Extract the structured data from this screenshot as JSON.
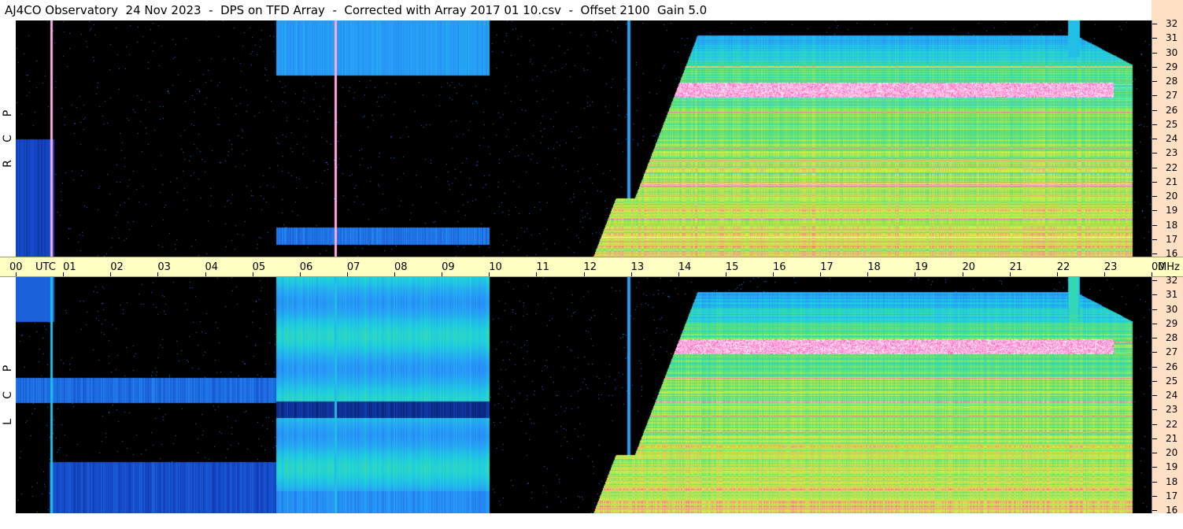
{
  "title": "AJ4CO Observatory  24 Nov 2023  -  DPS on TFD Array  -  Corrected with Array 2017 01 10.csv  -  Offset 2100  Gain 5.0",
  "panels": [
    {
      "id": "rcp",
      "polarization_letters": [
        "R",
        "C",
        "P"
      ]
    },
    {
      "id": "lcp",
      "polarization_letters": [
        "L",
        "C",
        "P"
      ]
    }
  ],
  "time_axis": {
    "labels": [
      "00",
      "UTC",
      "01",
      "02",
      "03",
      "04",
      "05",
      "06",
      "07",
      "08",
      "09",
      "10",
      "11",
      "12",
      "13",
      "14",
      "15",
      "16",
      "17",
      "18",
      "19",
      "20",
      "21",
      "22",
      "23",
      "00",
      "MHz"
    ]
  },
  "frequency_axis": {
    "labels": [
      "32",
      "31",
      "30",
      "29",
      "28",
      "27",
      "26",
      "25",
      "24",
      "23",
      "22",
      "21",
      "20",
      "19",
      "18",
      "17",
      "16"
    ]
  },
  "colors": {
    "background": "#000000",
    "time_axis_bg": "#ffffc4",
    "freq_axis_bg": "#ffe0c4",
    "low": "#0a1a60",
    "mid_blue": "#2a80f0",
    "cyan": "#20d0e0",
    "green": "#60e070",
    "yellow": "#e8f040",
    "magenta": "#ff40c0",
    "white": "#ffffff"
  },
  "chart_data": {
    "type": "heatmap",
    "title": "AJ4CO Observatory  24 Nov 2023  -  DPS on TFD Array  -  Corrected with Array 2017 01 10.csv  -  Offset 2100  Gain 5.0",
    "x_ticks": [
      "00",
      "01",
      "02",
      "03",
      "04",
      "05",
      "06",
      "07",
      "08",
      "09",
      "10",
      "11",
      "12",
      "13",
      "14",
      "15",
      "16",
      "17",
      "18",
      "19",
      "20",
      "21",
      "22",
      "23",
      "00"
    ],
    "x_unit": "UTC",
    "y_unit": "MHz",
    "y_range": [
      16,
      32
    ],
    "xlim_hours": [
      0,
      24
    ],
    "panels": [
      "RCP",
      "LCP"
    ],
    "features": [
      {
        "panel": "RCP",
        "hours": [
          5.5,
          10.0
        ],
        "mhz": [
          28,
          32
        ],
        "level": "mid_blue"
      },
      {
        "panel": "RCP",
        "hours": [
          12.5,
          23.8
        ],
        "mhz": [
          16,
          30
        ],
        "level": "green_yellow"
      },
      {
        "panel": "RCP",
        "hours": [
          13.2,
          23.2
        ],
        "mhz": [
          26.8,
          27.8
        ],
        "level": "white_magenta"
      },
      {
        "panel": "LCP",
        "hours": [
          5.5,
          10.0
        ],
        "mhz": [
          16,
          32
        ],
        "level": "cyan"
      },
      {
        "panel": "LCP",
        "hours": [
          0,
          5.5
        ],
        "mhz": [
          23.5,
          25
        ],
        "level": "mid_blue"
      },
      {
        "panel": "LCP",
        "hours": [
          12.5,
          23.8
        ],
        "mhz": [
          16,
          30
        ],
        "level": "green_yellow"
      },
      {
        "panel": "LCP",
        "hours": [
          13.2,
          23.2
        ],
        "mhz": [
          26.8,
          27.8
        ],
        "level": "white_magenta"
      }
    ]
  }
}
